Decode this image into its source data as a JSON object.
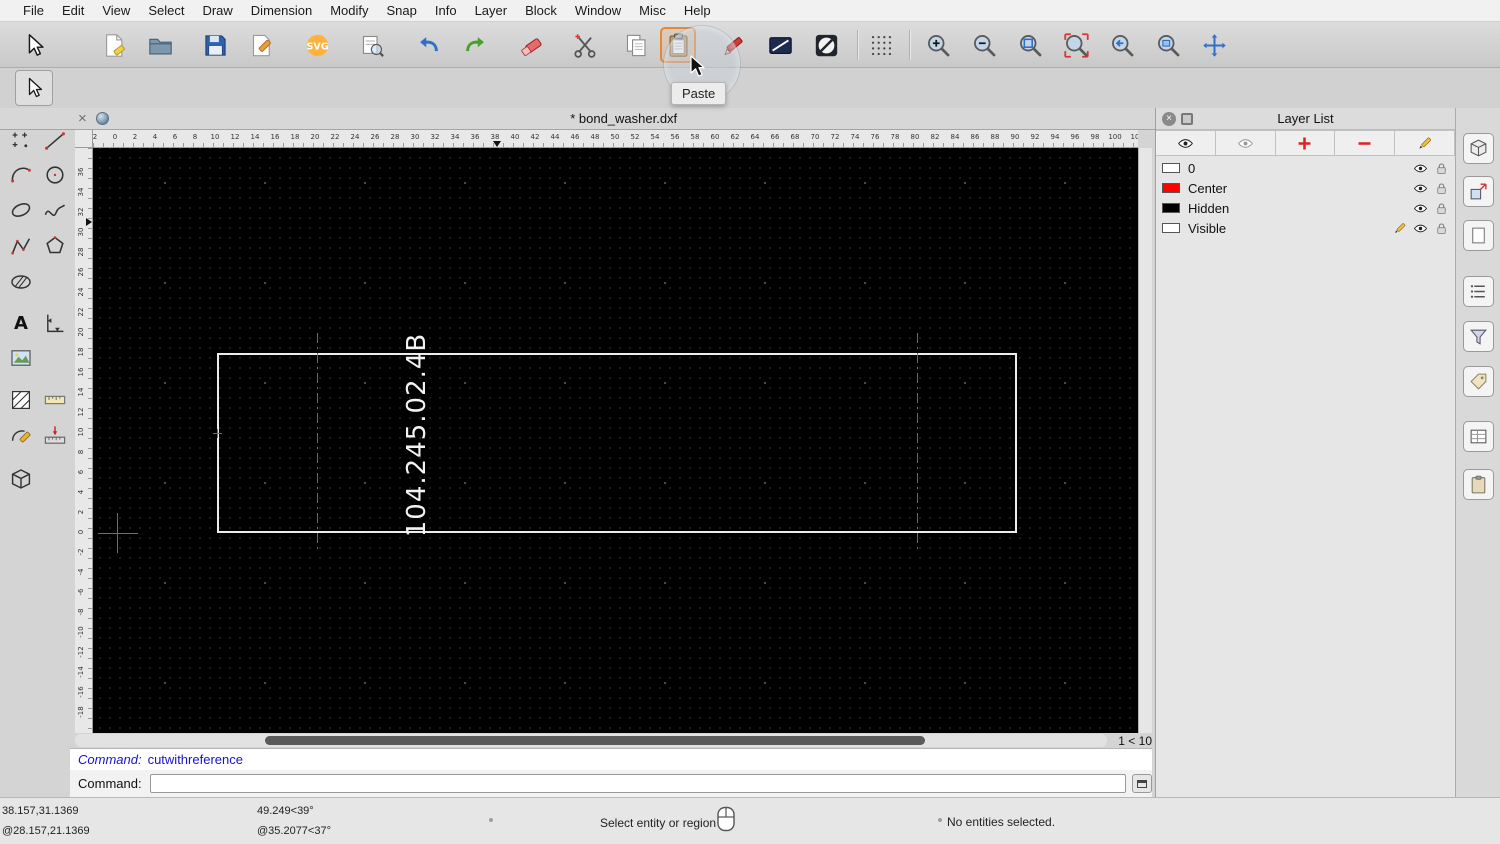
{
  "menubar": {
    "items": [
      "File",
      "Edit",
      "View",
      "Select",
      "Draw",
      "Dimension",
      "Modify",
      "Snap",
      "Info",
      "Layer",
      "Block",
      "Window",
      "Misc",
      "Help"
    ]
  },
  "toolbar": {
    "active": "paste",
    "tooltip": "Paste",
    "buttons": [
      {
        "name": "select",
        "icon": "cursor"
      },
      {
        "name": "new-document",
        "icon": "newdoc"
      },
      {
        "name": "open",
        "icon": "folder"
      },
      {
        "name": "save",
        "icon": "floppy"
      },
      {
        "name": "save-as",
        "icon": "savepen"
      },
      {
        "name": "export-svg",
        "icon": "svglogo"
      },
      {
        "name": "print-preview",
        "icon": "printpre"
      },
      {
        "name": "undo",
        "icon": "undo"
      },
      {
        "name": "redo",
        "icon": "redo"
      },
      {
        "name": "erase",
        "icon": "eraser"
      },
      {
        "name": "cut",
        "icon": "scissors"
      },
      {
        "name": "copy",
        "icon": "copy"
      },
      {
        "name": "paste",
        "icon": "clipboard"
      },
      {
        "name": "pen-edit",
        "icon": "redpen"
      },
      {
        "name": "draw-order",
        "icon": "darkline"
      },
      {
        "name": "stop-actions",
        "icon": "circleslash"
      },
      {
        "name": "grid-snap",
        "icon": "griddots"
      },
      {
        "name": "zoom-in",
        "icon": "zin"
      },
      {
        "name": "zoom-out",
        "icon": "zout"
      },
      {
        "name": "zoom-auto",
        "icon": "zauto"
      },
      {
        "name": "zoom-select",
        "icon": "zsel"
      },
      {
        "name": "zoom-previous",
        "icon": "zprev"
      },
      {
        "name": "zoom-window",
        "icon": "zwin"
      },
      {
        "name": "zoom-pan",
        "icon": "zpan"
      }
    ]
  },
  "tool_options": {
    "buttons": [
      {
        "name": "select",
        "icon": "cursor"
      }
    ]
  },
  "tabbar": {
    "title": "* bond_washer.dxf"
  },
  "left_toolbar": {
    "tools": [
      "points",
      "line",
      "arc",
      "circle",
      "ellipse",
      "spline",
      "polyline",
      "polygon",
      "hatch",
      "text",
      "dimension",
      "image",
      "hatch-pattern",
      "ruler",
      "polyline-edit",
      "measure",
      "block"
    ]
  },
  "canvas": {
    "ruler_top": {
      "labels": [
        "2",
        "0",
        "2",
        "4",
        "6",
        "8",
        "10",
        "12",
        "14",
        "16",
        "18",
        "20",
        "22",
        "24",
        "26",
        "28",
        "30",
        "32",
        "34",
        "36",
        "38",
        "40",
        "42",
        "44",
        "46",
        "48",
        "50",
        "52",
        "54",
        "56",
        "58",
        "60",
        "62",
        "64",
        "66",
        "68",
        "70",
        "72",
        "74",
        "76",
        "78",
        "80",
        "82",
        "84",
        "86",
        "88",
        "90",
        "92",
        "94",
        "96",
        "98",
        "100",
        "10"
      ]
    },
    "ruler_left": {
      "labels": [
        "36",
        "34",
        "32",
        "30",
        "28",
        "26",
        "24",
        "22",
        "20",
        "18",
        "16",
        "14",
        "12",
        "10",
        "8",
        "6",
        "4",
        "2",
        "0",
        "-2",
        "-4",
        "-6",
        "-8",
        "-10",
        "-12",
        "-14",
        "-16",
        "-18"
      ]
    },
    "grid_status": "1 < 10",
    "drawing": {
      "part_label": "104.245.02.4B"
    }
  },
  "layer_list": {
    "title": "Layer List",
    "toolbar": [
      "show-all-layers",
      "hide-all-layers",
      "add-layer",
      "remove-layer",
      "edit-layer"
    ],
    "layers": [
      {
        "name": "0",
        "color": "#ffffff",
        "visible": true,
        "locked": false,
        "current": false
      },
      {
        "name": "Center",
        "color": "#ff0000",
        "visible": true,
        "locked": false,
        "current": false
      },
      {
        "name": "Hidden",
        "color": "#000000",
        "visible": true,
        "locked": false,
        "current": false
      },
      {
        "name": "Visible",
        "color": "#ffffff",
        "visible": true,
        "locked": false,
        "current": true
      }
    ]
  },
  "right_dock": {
    "icons": [
      "cube",
      "block",
      "page",
      "list",
      "funnel",
      "tag",
      "table",
      "clipboard"
    ]
  },
  "command_area": {
    "history_label": "Command:",
    "history_value": "cutwithreference",
    "prompt_label": "Command:",
    "input_value": ""
  },
  "statusbar": {
    "absolute_coords": "38.157,31.1369",
    "relative_coords": "@28.157,21.1369",
    "absolute_polar": "49.249<39°",
    "relative_polar": "@35.2077<37°",
    "action_hint": "Select entity or region",
    "selection_status": "No entities selected."
  },
  "colors": {
    "entity": "#ffffff",
    "centerline": "#ff3030",
    "canvas_background": "#000000",
    "active_tool_highlight": "#e2893b"
  }
}
